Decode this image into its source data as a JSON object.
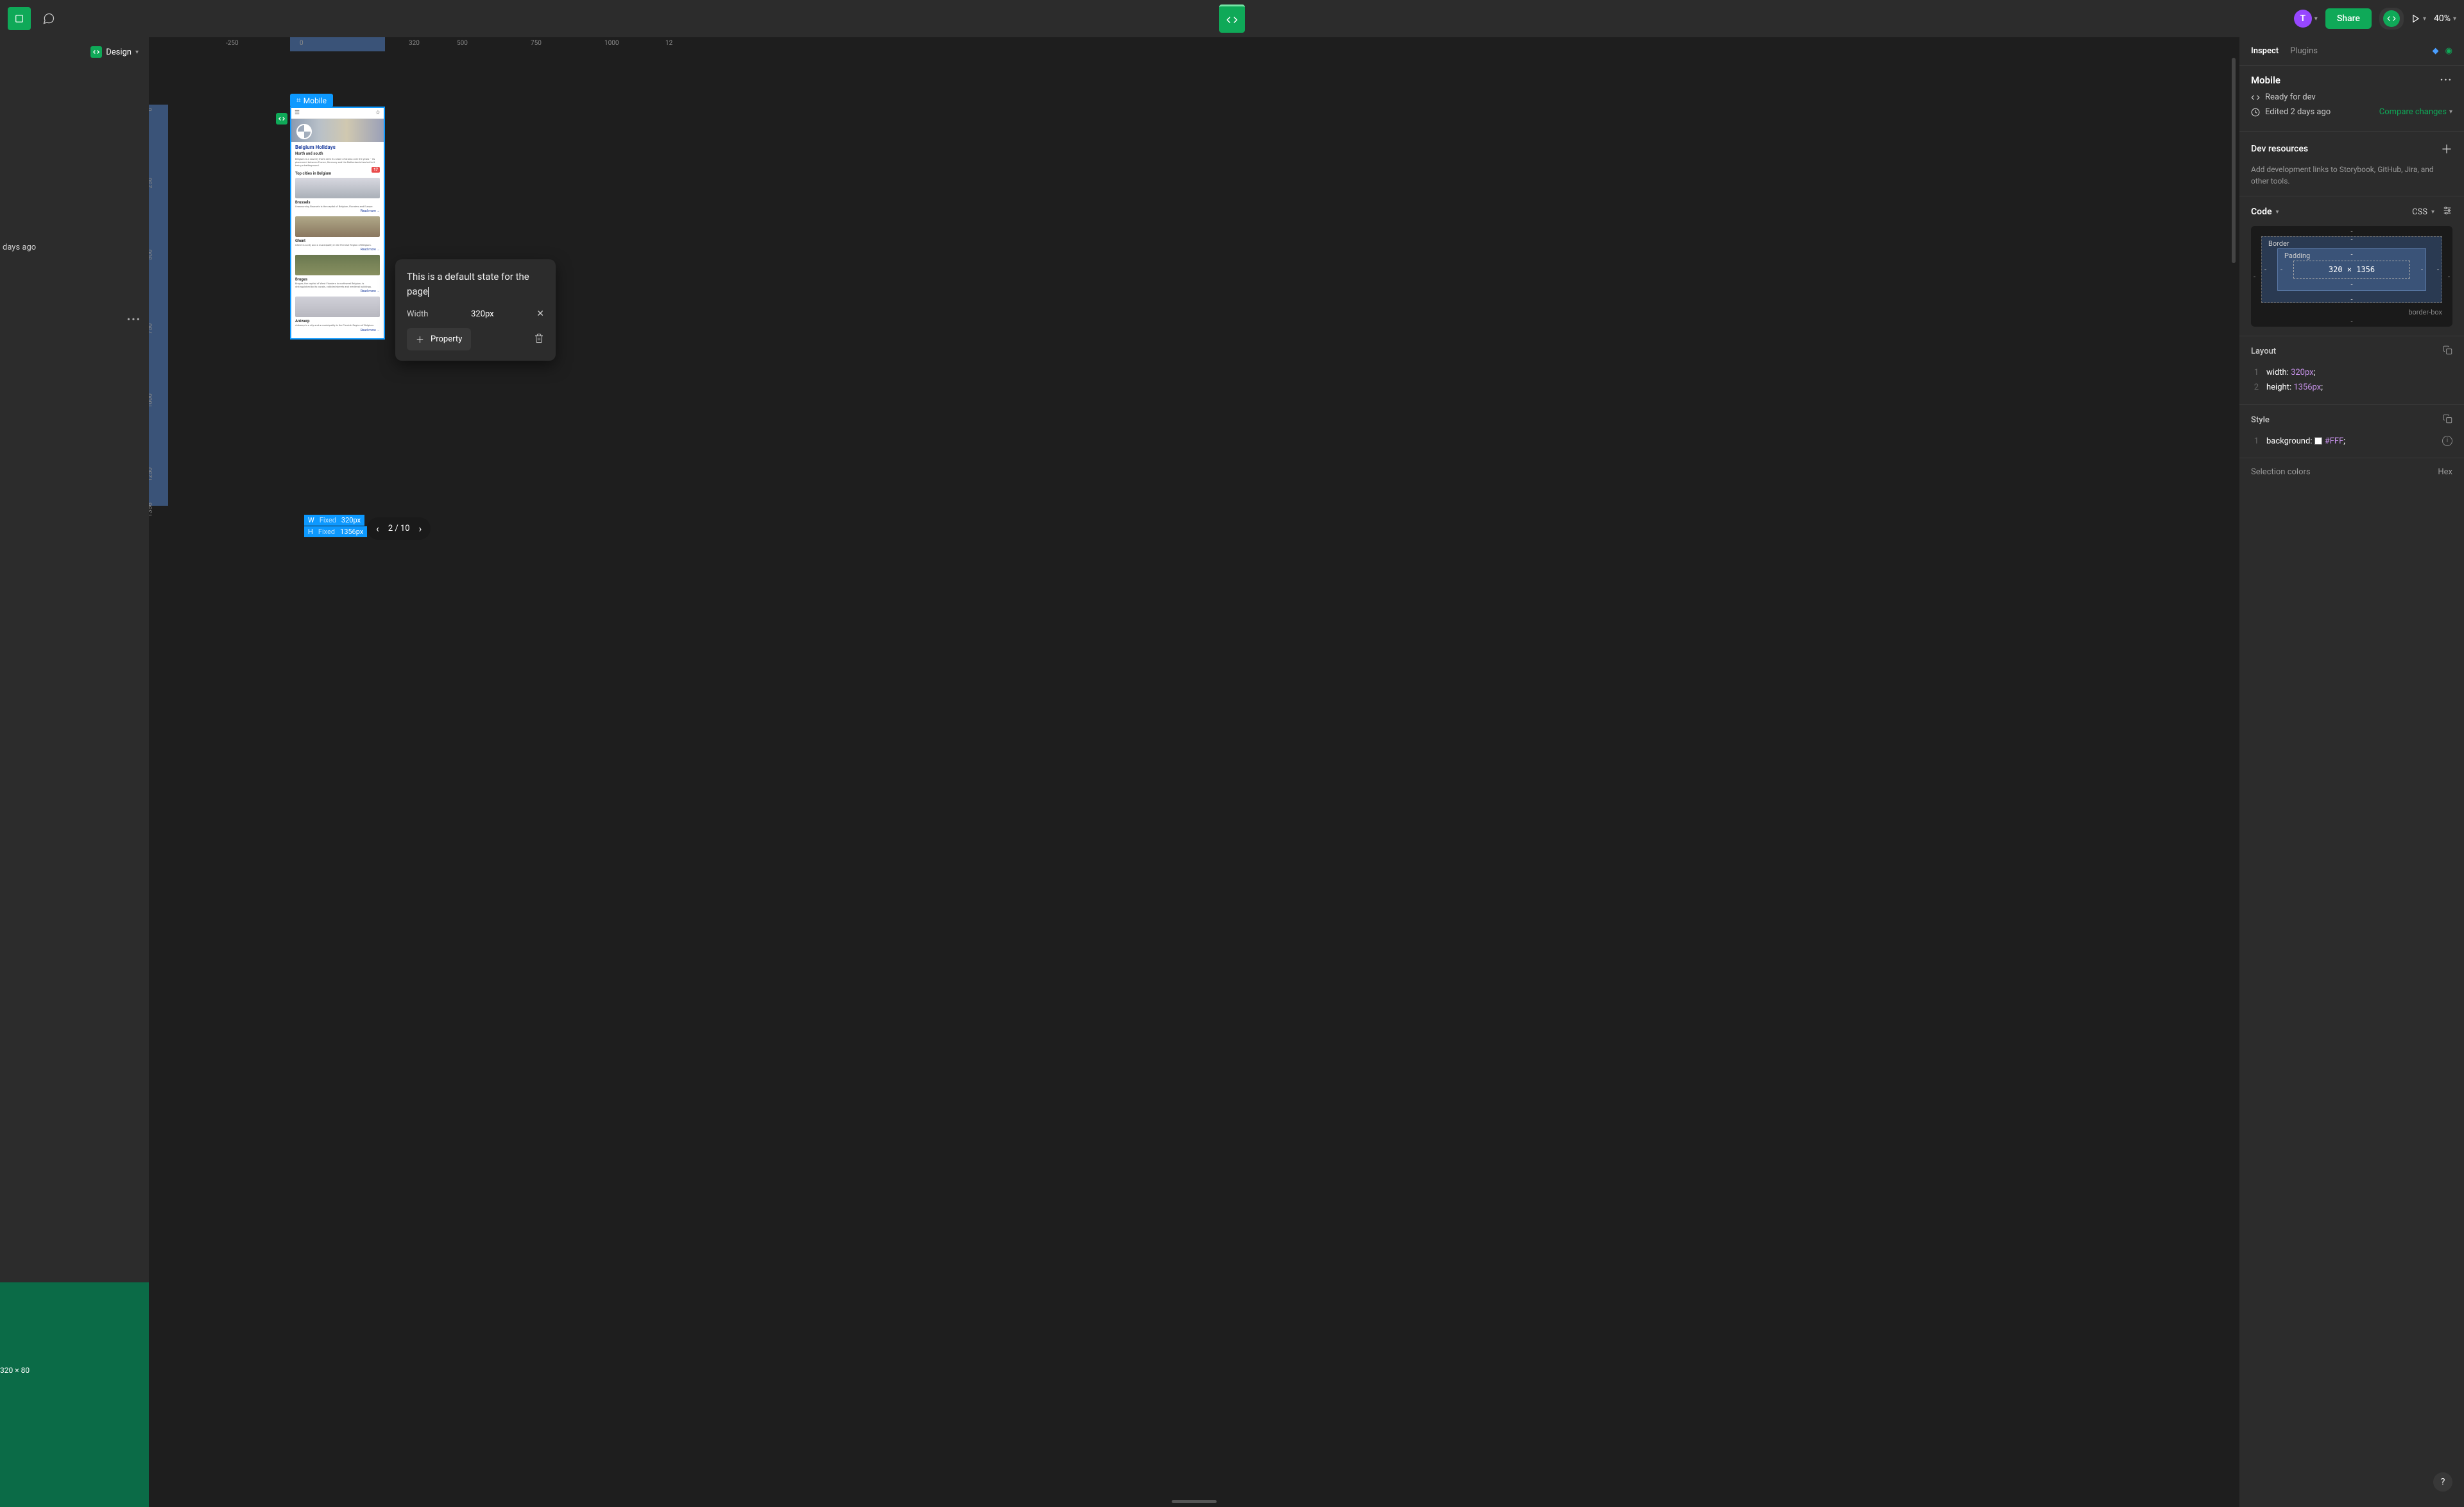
{
  "toolbar": {
    "share_label": "Share",
    "zoom": "40%",
    "avatar_letter": "T"
  },
  "left_panel": {
    "design_tab": "Design",
    "ago_text": "days ago",
    "dims_text": "320 × 80"
  },
  "rulers": {
    "h": [
      "-250",
      "0",
      "320",
      "500",
      "750",
      "1000",
      "12"
    ],
    "v": [
      "0",
      "250",
      "500",
      "750",
      "1000",
      "1250",
      "1356"
    ]
  },
  "frame": {
    "label": "Mobile",
    "title": "Belgium Holidays",
    "subtitle": "North and south",
    "desc": "Belgium is a country that's seen its share of drama over the years – its placement between France, Germany and the Netherlands has led to it being a battleground.",
    "badge_num": "17",
    "section_title": "Top cities in Belgium",
    "cities": [
      {
        "name": "Brussels",
        "desc": "Unassuming Brussels is the capital of Belgium, Flanders and Europe.",
        "read": "Read more →"
      },
      {
        "name": "Ghent",
        "desc": "Ghent is a city and a municipality in the Flemish Region of Belgium.",
        "read": "Read more →"
      },
      {
        "name": "Bruges",
        "desc": "Bruges, the capital of West Flanders in northwest Belgium, is distinguished by its canals, cobbled streets and medieval buildings.",
        "read": "Read more →"
      },
      {
        "name": "Antwerp",
        "desc": "Antwerp is a city and a municipality in the Flemish Region of Belgium.",
        "read": "Read more →"
      }
    ],
    "dims": {
      "w_label": "W",
      "w_mode": "Fixed",
      "w_val": "320px",
      "h_label": "H",
      "h_mode": "Fixed",
      "h_val": "1356px"
    }
  },
  "pager": {
    "value": "2 / 10"
  },
  "annotation": {
    "text": "This is a default state for the page",
    "width_label": "Width",
    "width_value": "320px",
    "add_label": "Property"
  },
  "inspect": {
    "tabs": {
      "inspect": "Inspect",
      "plugins": "Plugins"
    },
    "frame_name": "Mobile",
    "ready": "Ready for dev",
    "edited": "Edited 2 days ago",
    "compare": "Compare changes",
    "dev_res_title": "Dev resources",
    "dev_res_desc": "Add development links to Storybook, GitHub, Jira, and other tools.",
    "code_title": "Code",
    "css_label": "CSS",
    "box_model": {
      "border_label": "Border",
      "padding_label": "Padding",
      "content": "320 × 1356",
      "dash": "-",
      "sizing": "border-box"
    },
    "layout_title": "Layout",
    "layout_code": [
      {
        "n": "1",
        "prop": "width",
        "val": "320px"
      },
      {
        "n": "2",
        "prop": "height",
        "val": "1356px"
      }
    ],
    "style_title": "Style",
    "style_code": [
      {
        "n": "1",
        "prop": "background",
        "val": "#FFF"
      }
    ],
    "selection_colors": "Selection colors",
    "hex": "Hex"
  }
}
